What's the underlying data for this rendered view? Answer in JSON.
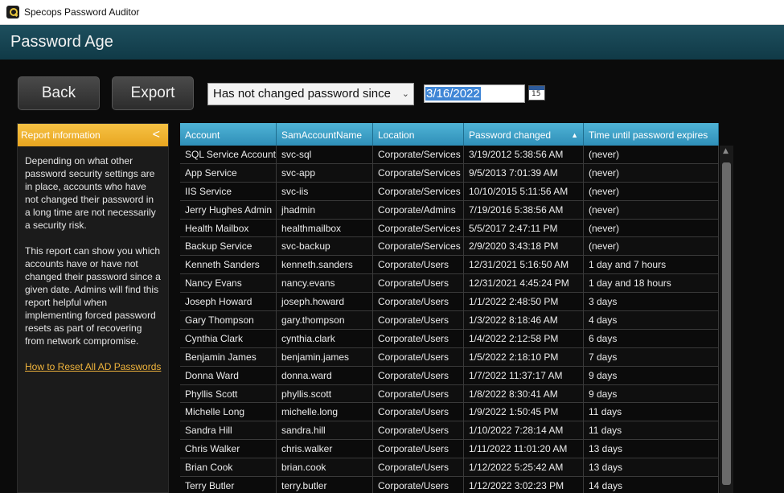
{
  "window": {
    "title": "Specops Password Auditor"
  },
  "header": {
    "title": "Password Age"
  },
  "toolbar": {
    "back_label": "Back",
    "export_label": "Export",
    "filter_value": "Has not changed password since",
    "date_value": "3/16/2022",
    "calendar_day": "15"
  },
  "sidebar": {
    "title": "Report information",
    "para1": "Depending on what other password security settings are in place, accounts who have not changed their password in a long time are not necessarily a security risk.",
    "para2": "This report can show you which accounts have or have not changed their password since a given date. Admins will find this report helpful when implementing forced password resets as part of recovering from network compromise.",
    "link": "How to Reset All AD Passwords"
  },
  "table": {
    "columns": [
      "Account",
      "SamAccountName",
      "Location",
      "Password changed",
      "Time until password expires"
    ],
    "sort_column": "Password changed",
    "rows": [
      [
        "SQL Service Account",
        "svc-sql",
        "Corporate/Services",
        "3/19/2012 5:38:56 AM",
        "(never)"
      ],
      [
        "App Service",
        "svc-app",
        "Corporate/Services",
        "9/5/2013 7:01:39 AM",
        "(never)"
      ],
      [
        "IIS Service",
        "svc-iis",
        "Corporate/Services",
        "10/10/2015 5:11:56 AM",
        "(never)"
      ],
      [
        "Jerry Hughes Admin",
        "jhadmin",
        "Corporate/Admins",
        "7/19/2016 5:38:56 AM",
        "(never)"
      ],
      [
        "Health Mailbox",
        "healthmailbox",
        "Corporate/Services",
        "5/5/2017 2:47:11 PM",
        "(never)"
      ],
      [
        "Backup Service",
        "svc-backup",
        "Corporate/Services",
        "2/9/2020 3:43:18 PM",
        "(never)"
      ],
      [
        "Kenneth Sanders",
        "kenneth.sanders",
        "Corporate/Users",
        "12/31/2021 5:16:50 AM",
        "1 day and 7 hours"
      ],
      [
        "Nancy Evans",
        "nancy.evans",
        "Corporate/Users",
        "12/31/2021 4:45:24 PM",
        "1 day and 18 hours"
      ],
      [
        "Joseph Howard",
        "joseph.howard",
        "Corporate/Users",
        "1/1/2022 2:48:50 PM",
        "3 days"
      ],
      [
        "Gary Thompson",
        "gary.thompson",
        "Corporate/Users",
        "1/3/2022 8:18:46 AM",
        "4 days"
      ],
      [
        "Cynthia Clark",
        "cynthia.clark",
        "Corporate/Users",
        "1/4/2022 2:12:58 PM",
        "6 days"
      ],
      [
        "Benjamin James",
        "benjamin.james",
        "Corporate/Users",
        "1/5/2022 2:18:10 PM",
        "7 days"
      ],
      [
        "Donna Ward",
        "donna.ward",
        "Corporate/Users",
        "1/7/2022 11:37:17 AM",
        "9 days"
      ],
      [
        "Phyllis Scott",
        "phyllis.scott",
        "Corporate/Users",
        "1/8/2022 8:30:41 AM",
        "9 days"
      ],
      [
        "Michelle Long",
        "michelle.long",
        "Corporate/Users",
        "1/9/2022 1:50:45 PM",
        "11 days"
      ],
      [
        "Sandra Hill",
        "sandra.hill",
        "Corporate/Users",
        "1/10/2022 7:28:14 AM",
        "11 days"
      ],
      [
        "Chris Walker",
        "chris.walker",
        "Corporate/Users",
        "1/11/2022 11:01:20 AM",
        "13 days"
      ],
      [
        "Brian Cook",
        "brian.cook",
        "Corporate/Users",
        "1/12/2022 5:25:42 AM",
        "13 days"
      ],
      [
        "Terry Butler",
        "terry.butler",
        "Corporate/Users",
        "1/12/2022 3:02:23 PM",
        "14 days"
      ]
    ]
  },
  "colors": {
    "header_bg": "#1e4f5e",
    "accent": "#f0b43c",
    "grid_header": "#3fa3c9"
  }
}
